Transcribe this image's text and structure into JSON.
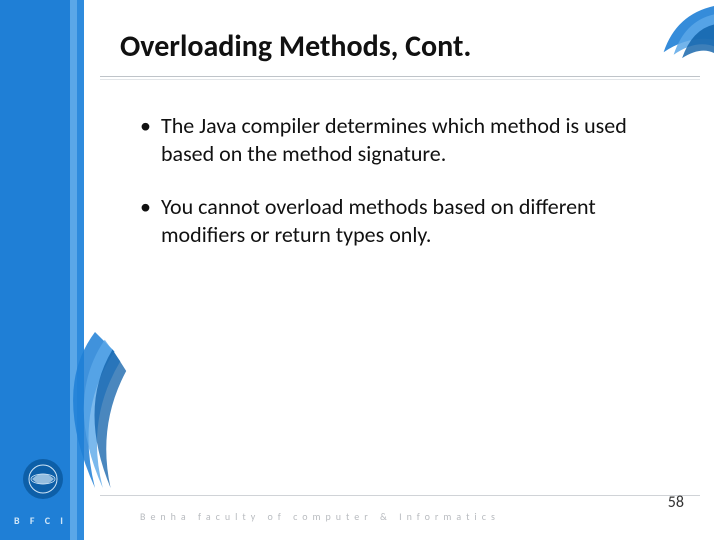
{
  "title": "Overloading Methods, Cont.",
  "bullets": [
    "The Java compiler determines which method is used based on the method signature.",
    " You cannot overload methods based on different modifiers or return types only."
  ],
  "page_number": "58",
  "footer": {
    "brand_short": "B F C I",
    "brand_long": "Benha faculty of computer & Informatics"
  },
  "colors": {
    "primary": "#1f7fd6",
    "accent1": "#5aa7e8",
    "accent2": "#2e8bdd"
  }
}
